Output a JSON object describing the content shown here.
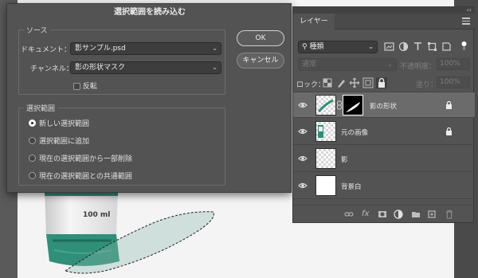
{
  "dialog": {
    "title": "選択範囲を読み込む",
    "source": {
      "legend": "ソース",
      "document_label": "ドキュメント：",
      "document_value": "影サンプル.psd",
      "channel_label": "チャンネル：",
      "channel_value": "影の形状マスク",
      "invert_label": "反転"
    },
    "operation": {
      "legend": "選択範囲",
      "options": [
        {
          "label": "新しい選択範囲",
          "checked": true
        },
        {
          "label": "選択範囲に追加",
          "checked": false
        },
        {
          "label": "現在の選択範囲から一部削除",
          "checked": false
        },
        {
          "label": "現在の選択範囲との共通範囲",
          "checked": false
        }
      ]
    },
    "ok_label": "OK",
    "cancel_label": "キャンセル"
  },
  "layers_panel": {
    "tab_label": "レイヤー",
    "kind_label": "種類",
    "blend_mode": "通常",
    "opacity_label": "不透明度：",
    "opacity_value": "100%",
    "lock_label": "ロック：",
    "fill_label": "塗り：",
    "fill_value": "100%",
    "layers": [
      {
        "name": "影の形状",
        "selected": true,
        "locked": true,
        "has_mask": true
      },
      {
        "name": "元の画像",
        "selected": false,
        "locked": true,
        "has_mask": false
      },
      {
        "name": "影",
        "selected": false,
        "locked": false,
        "has_mask": false
      },
      {
        "name": "背景白",
        "selected": false,
        "locked": false,
        "has_mask": false
      }
    ]
  },
  "canvas": {
    "product_label": "100 ml"
  },
  "colors": {
    "dialog_bg": "#535353",
    "panel_bg": "#535353",
    "selected_layer": "#6b6b6b",
    "tube_green": "#2f8f78"
  }
}
